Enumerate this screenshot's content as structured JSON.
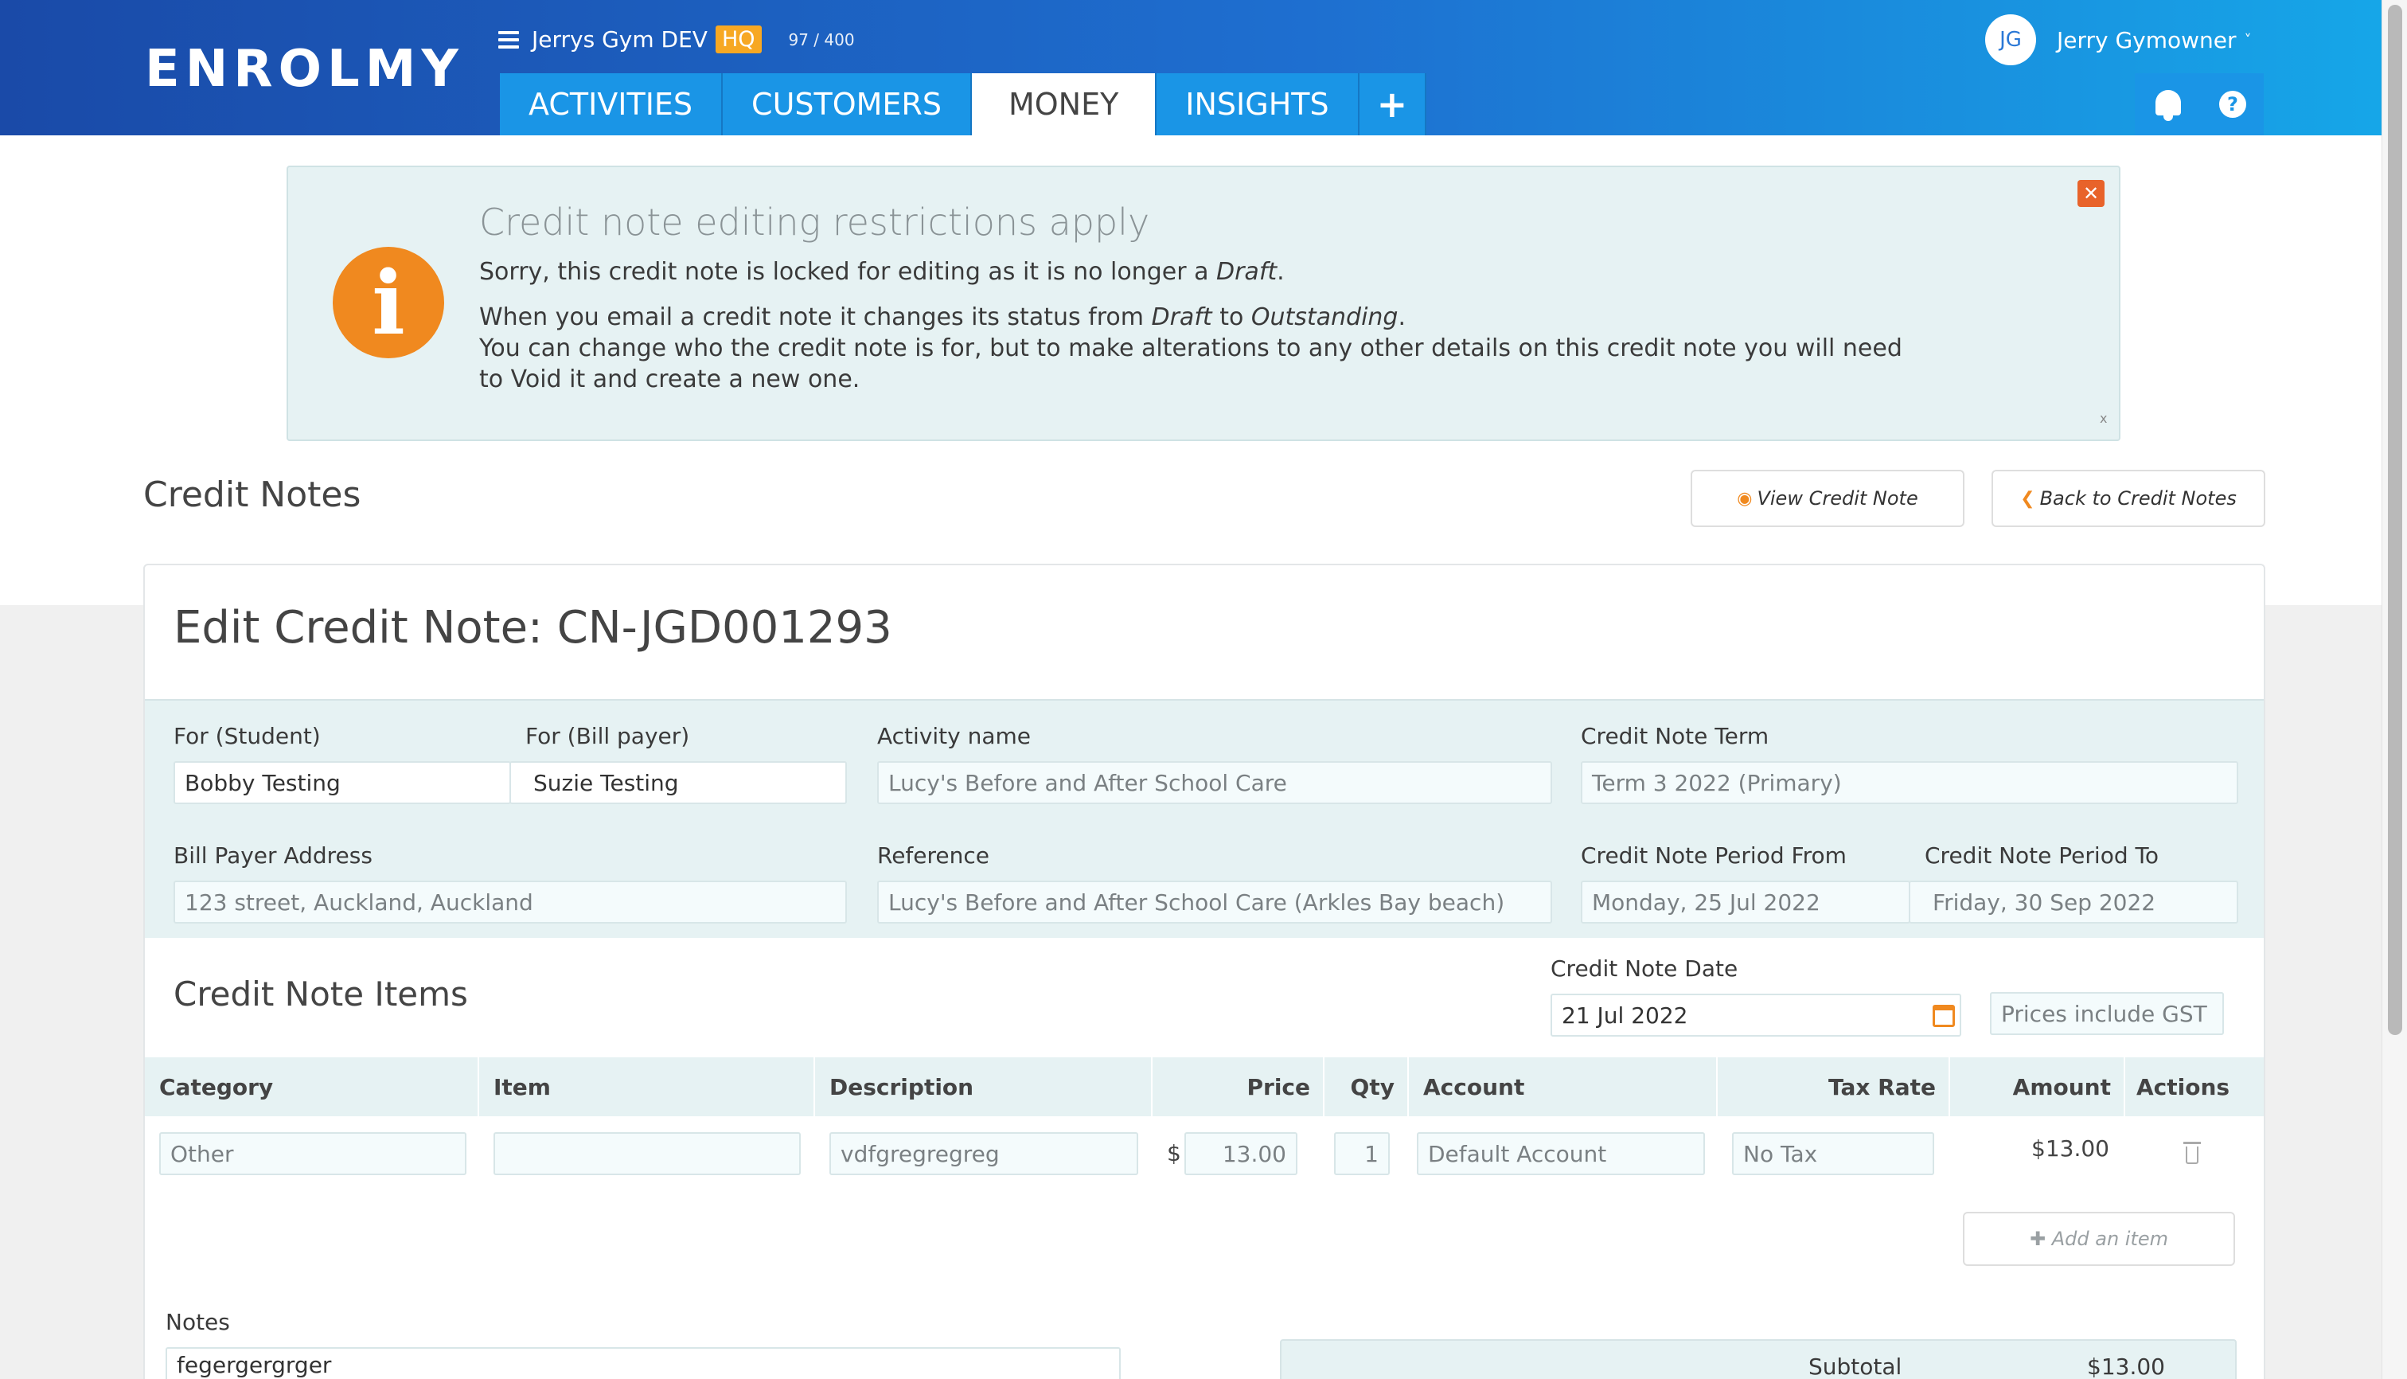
{
  "app": {
    "logo": "ENROLMY"
  },
  "header": {
    "gym_name": "Jerrys Gym DEV",
    "hq_badge": "HQ",
    "count": "97 / 400",
    "tabs": [
      {
        "label": "ACTIVITIES"
      },
      {
        "label": "CUSTOMERS"
      },
      {
        "label": "MONEY",
        "active": true
      },
      {
        "label": "INSIGHTS"
      },
      {
        "label": "+"
      }
    ],
    "user": {
      "initials": "JG",
      "name": "Jerry Gymowner",
      "caret": "˅"
    },
    "icons": {
      "notifications": "bell-icon",
      "help": "help-icon",
      "help_glyph": "?"
    }
  },
  "alert": {
    "title": "Credit note editing restrictions apply",
    "line1_pre": "Sorry, this credit note is locked for editing as it is no longer a ",
    "line1_em": "Draft",
    "line1_post": ".",
    "line2_pre": "When you email a credit note it changes its status from ",
    "line2_em1": "Draft",
    "line2_mid": " to ",
    "line2_em2": "Outstanding",
    "line2_post": ".",
    "line3": "You can change who the credit note is for, but to make alterations to any other details on this credit note you will need to Void it and create a new one.",
    "close_glyph": "✕",
    "small_x": "x",
    "icon_glyph": "i"
  },
  "page": {
    "title": "Credit Notes",
    "view_button": "View Credit Note",
    "back_button": "Back to Credit Notes"
  },
  "form": {
    "edit_title": "Edit Credit Note: CN-JGD001293",
    "student_label": "For (Student)",
    "student_value": "Bobby Testing",
    "billpayer_label": "For (Bill payer)",
    "billpayer_value": "Suzie Testing",
    "activity_label": "Activity name",
    "activity_value": "Lucy's Before and After School Care",
    "term_label": "Credit Note Term",
    "term_value": "Term 3 2022 (Primary)",
    "address_label": "Bill Payer Address",
    "address_value": "123 street, Auckland, Auckland",
    "reference_label": "Reference",
    "reference_value": "Lucy's Before and After School Care (Arkles Bay beach)",
    "period_from_label": "Credit Note Period From",
    "period_from_value": "Monday, 25 Jul 2022",
    "period_to_label": "Credit Note Period To",
    "period_to_value": "Friday, 30 Sep 2022"
  },
  "items": {
    "title": "Credit Note Items",
    "date_label": "Credit Note Date",
    "date_value": "21 Jul 2022",
    "gst_value": "Prices include GST",
    "columns": [
      "Category",
      "Item",
      "Description",
      "Price",
      "Qty",
      "Account",
      "Tax Rate",
      "Amount",
      "Actions"
    ],
    "row": {
      "category": "Other",
      "item": "",
      "description": "vdfgregregreg",
      "currency": "$",
      "price": "13.00",
      "qty": "1",
      "account": "Default Account",
      "tax_rate": "No Tax",
      "amount": "$13.00"
    },
    "add_item": "Add an item"
  },
  "notes": {
    "label": "Notes",
    "value": "fegergergrger"
  },
  "totals": {
    "subtotal_label": "Subtotal",
    "subtotal_value": "$13.00"
  },
  "colors": {
    "accent": "#f0891f",
    "header_start": "#1a4aa8",
    "header_end": "#16a6e8",
    "panel": "#e6f2f3"
  }
}
